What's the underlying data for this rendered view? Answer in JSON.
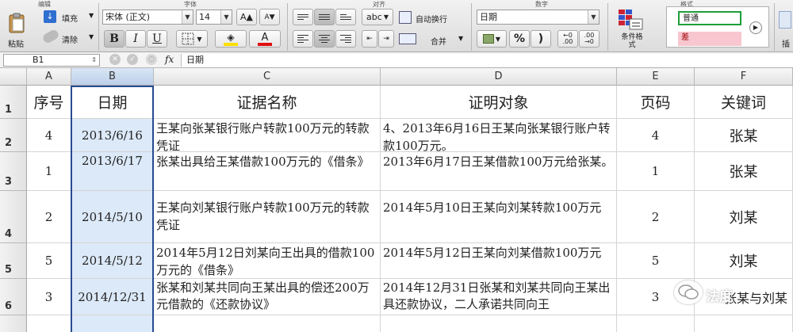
{
  "ribbon": {
    "groups": {
      "edit": "编辑",
      "font": "字体",
      "align": "对齐",
      "number": "数字",
      "format": "格式"
    },
    "paste_label": "粘贴",
    "fill_label": "填充",
    "clear_label": "清除",
    "font_name": "宋体 (正文)",
    "font_size": "14",
    "bold_label": "B",
    "italic_label": "I",
    "underline_label": "U",
    "font_color_label": "A",
    "wrap_prefix": "abc",
    "wrap_label": "自动换行",
    "merge_label": "合并",
    "number_format": "日期",
    "percent_label": "%",
    "comma_label": ")",
    "dec_inc_label": "←0 .00",
    "dec_dec_label": ".00 →0",
    "cond_format_label": "条件格式",
    "style_normal": "普通",
    "style_bad": "差",
    "insert_label": "插",
    "colors": {
      "good_border": "#1e9e3a",
      "bad_bg": "#f7c6ce",
      "bad_text": "#9c0006",
      "font_red": "#e01010",
      "fill_yellow": "#ffdf00"
    }
  },
  "formula_bar": {
    "cell_ref": "B1",
    "fx": "fx",
    "value": "日期"
  },
  "columns": [
    "A",
    "B",
    "C",
    "D",
    "E",
    "F"
  ],
  "rows": [
    "1",
    "2",
    "3",
    "4",
    "5",
    "6"
  ],
  "table": {
    "header": {
      "a": "序号",
      "b": "日期",
      "c": "证据名称",
      "d": "证明对象",
      "e": "页码",
      "f": "关键词"
    },
    "rows": [
      {
        "a": "4",
        "b": "2013/6/16",
        "c": "王某向张某银行账户转款100万元的转款凭证",
        "d": "4、2013年6月16日王某向张某银行账户转款100万元。",
        "e": "4",
        "f": "张某"
      },
      {
        "a": "1",
        "b": "2013/6/17",
        "c": "张某出具给王某借款100万元的《借条》",
        "d": "2013年6月17日王某借款100万元给张某。",
        "e": "1",
        "f": "张某"
      },
      {
        "a": "2",
        "b": "2014/5/10",
        "c": "王某向刘某银行账户转款100万元的转款凭证",
        "d": "2014年5月10日王某向刘某转款100万元",
        "e": "2",
        "f": "刘某"
      },
      {
        "a": "5",
        "b": "2014/5/12",
        "c": "2014年5月12日刘某向王出具的借款100万元的《借条》",
        "d": "2014年5月12日王某向刘某借款100万元",
        "e": "5",
        "f": "刘某"
      },
      {
        "a": "3",
        "b": "2014/12/31",
        "c": "张某和刘某共同向王某出具的偿还200万元借款的《还款协议》",
        "d": "2014年12月31日张某和刘某共同向王某出具还款协议，二人承诺共同向王",
        "e": "3",
        "f": "张某与刘某"
      }
    ]
  },
  "watermark": {
    "text": "法度"
  }
}
